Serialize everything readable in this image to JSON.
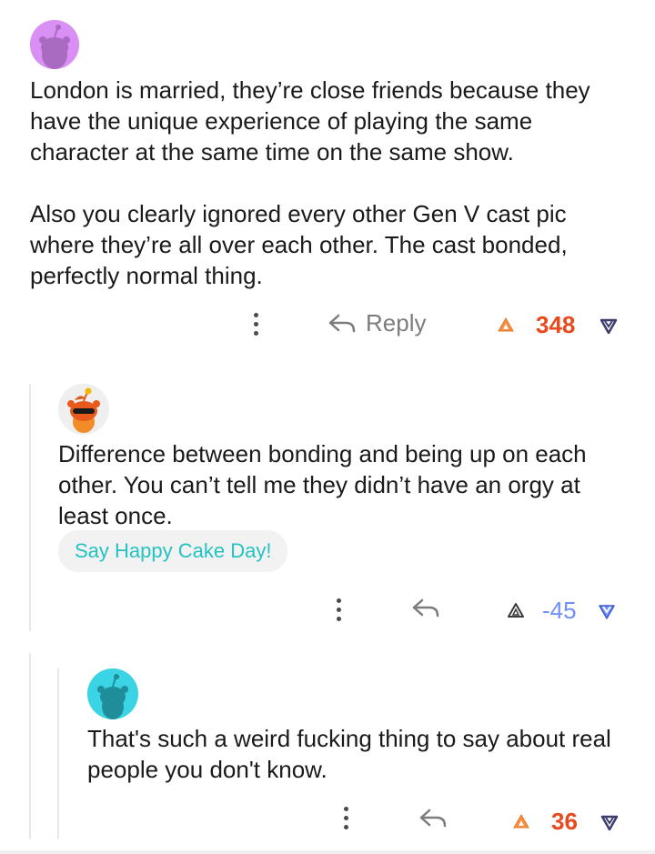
{
  "colors": {
    "upvote_orange": "#ff4500",
    "downvote_blue": "#7193ff",
    "cake_teal": "#24c2c2",
    "thread_line": "#e8e8e8"
  },
  "comments": [
    {
      "avatar": "purple-snoo-avatar",
      "text": "London is married, they’re close friends because they have the unique experience of playing the same character at the same time on the same show.\n\nAlso you clearly ignored every other Gen V cast pic where they’re all over each other. The cast bonded, perfectly normal thing.",
      "reply_label": "Reply",
      "score": "348",
      "vote_state": "upvoted"
    },
    {
      "avatar": "orange-snoo-avatar",
      "text": "Difference between bonding and being up on each other. You can’t tell me they didn’t have an orgy at least once.",
      "cake_day_label": "Say Happy Cake Day!",
      "score": "-45",
      "vote_state": "downvoted"
    },
    {
      "avatar": "teal-snoo-avatar",
      "text": "That's such a weird fucking thing to say about real people you don't know.",
      "score": "36",
      "vote_state": "upvoted"
    }
  ]
}
